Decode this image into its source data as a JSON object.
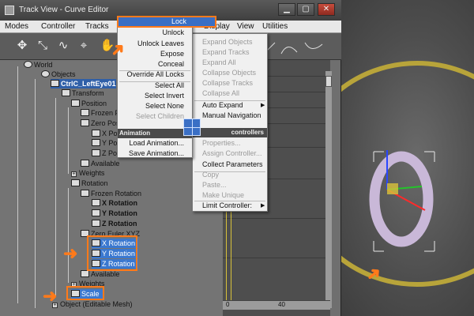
{
  "window": {
    "title": "Track View - Curve Editor",
    "controls": {
      "minimize": "▁",
      "maximize": "▢",
      "close": "✕"
    }
  },
  "menubar": {
    "items": [
      "Modes",
      "Controller",
      "Tracks",
      "Display",
      "View",
      "Utilities"
    ]
  },
  "toolbar": {
    "icons": [
      "move-keys-icon",
      "slide-keys-icon",
      "add-keys-icon",
      "draw-curves-icon",
      "pan-icon"
    ]
  },
  "tree": {
    "world": "World",
    "objects": "Objects",
    "ctrl": "CtrlC_LeftEye01",
    "transform": "Transform",
    "position": "Position",
    "frozen_pos": "Frozen P",
    "zero_pos": "Zero Pos",
    "x_pos": "X Pos",
    "y_pos": "Y Pos",
    "z_pos": "Z Pos",
    "available1": "Available",
    "weights1": "Weights",
    "rotation": "Rotation",
    "frozen_rotation": "Frozen Rotation",
    "x_rotation_frozen": "X Rotation",
    "y_rotation_frozen": "Y Rotation",
    "z_rotation_frozen": "Z Rotation",
    "zero_euler": "Zero Euler XYZ",
    "x_rotation": "X Rotation",
    "y_rotation": "Y Rotation",
    "z_rotation": "Z Rotation",
    "available2": "Available",
    "weights2": "Weights",
    "scale": "Scale",
    "object": "Object (Editable Mesh)"
  },
  "context_left": {
    "lock": "Lock",
    "items": [
      "Unlock",
      "Unlock Leaves",
      "Expose",
      "Conceal",
      "Override All Locks",
      "Select All",
      "Select Invert",
      "Select None",
      "Select Children"
    ],
    "section_header": "Animation",
    "load": "Load Animation...",
    "save": "Save Animation..."
  },
  "context_right": {
    "items": [
      "Expand Objects",
      "Expand Tracks",
      "Expand All",
      "Collapse Objects",
      "Collapse Tracks",
      "Collapse All"
    ],
    "auto_expand": "Auto Expand",
    "manual_navigation": "Manual Navigation",
    "section_header": "controllers",
    "properties": "Properties...",
    "assign_controller": "Assign Controller...",
    "collect_parameters": "Collect Parameters",
    "copy": "Copy",
    "paste": "Paste...",
    "make_unique": "Make Unique",
    "limit_controller": "Limit Controller:"
  },
  "timeline": {
    "frame_start": "0",
    "frame_40": "40"
  },
  "colors": {
    "accent": "#ff7a1a",
    "selection": "#3a78d0",
    "window_bg": "#6f6f6f"
  }
}
